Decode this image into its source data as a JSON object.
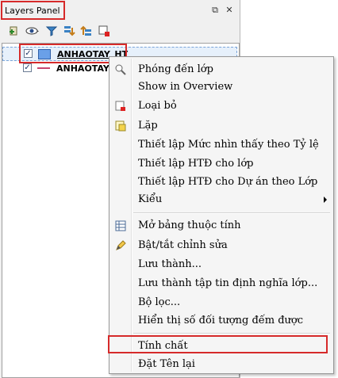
{
  "panel": {
    "title": "Layers Panel",
    "float_icon": "⧉",
    "close_icon": "✕",
    "toolbar_icons": [
      "add-group-icon",
      "visibility-eye-icon",
      "filter-icon",
      "expand-all-icon",
      "collapse-all-icon",
      "remove-layer-icon"
    ]
  },
  "layers": [
    {
      "name": "ANHAOTAY_HT",
      "checked": true,
      "symbol": "polygon",
      "color": "#6aa0e8"
    },
    {
      "name": "ANHAOTAY_",
      "checked": true,
      "symbol": "line",
      "color": "#c8456f"
    }
  ],
  "context_menu": {
    "items": [
      {
        "label": "Phóng đến lớp",
        "icon": "zoom-to-layer-icon"
      },
      {
        "label": "Show in Overview",
        "icon": ""
      },
      {
        "label": "Loại bỏ",
        "icon": "remove-icon"
      },
      {
        "label": "Lặp",
        "icon": "duplicate-icon"
      },
      {
        "label": "Thiết lập Mức nhìn thấy theo Tỷ lệ",
        "icon": ""
      },
      {
        "label": "Thiết lập HTĐ cho lớp",
        "icon": ""
      },
      {
        "label": "Thiết lập HTĐ cho Dự án theo Lớp",
        "icon": ""
      },
      {
        "label": "Kiểu",
        "icon": "",
        "submenu": true
      },
      {
        "label": "Mở bảng thuộc tính",
        "icon": "attribute-table-icon"
      },
      {
        "label": "Bật/tắt chỉnh sửa",
        "icon": "pencil-icon"
      },
      {
        "label": "Lưu thành...",
        "icon": ""
      },
      {
        "label": "Lưu thành tập tin định nghĩa lớp...",
        "icon": ""
      },
      {
        "label": "Bộ lọc...",
        "icon": ""
      },
      {
        "label": "Hiển thị số đối tượng đếm được",
        "icon": ""
      },
      {
        "label": "Tính chất",
        "icon": ""
      },
      {
        "label": "Đặt Tên lại",
        "icon": ""
      }
    ]
  },
  "colors": {
    "highlight": "#d62a2a",
    "selection": "#e6f0fb"
  }
}
